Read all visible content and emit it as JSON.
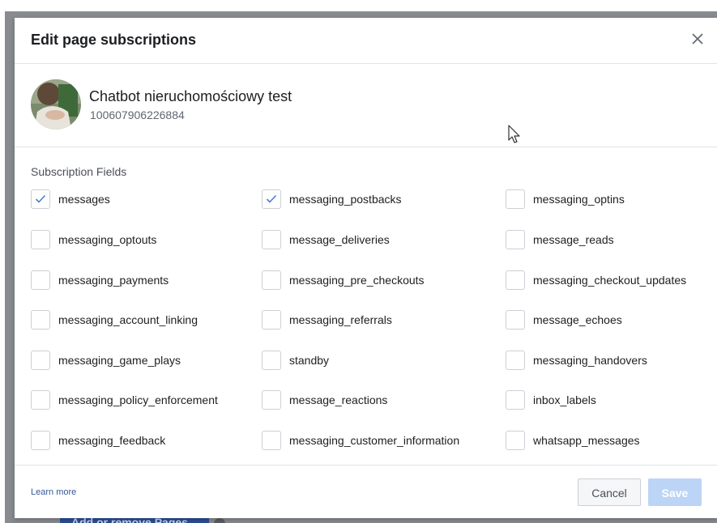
{
  "dialog": {
    "title": "Edit page subscriptions",
    "close_icon": "close-icon"
  },
  "page": {
    "name": "Chatbot nieruchomościowy test",
    "id": "100607906226884",
    "avatar_icon": "page-avatar"
  },
  "subscriptions": {
    "label": "Subscription Fields",
    "fields": [
      {
        "label": "messages",
        "checked": true
      },
      {
        "label": "messaging_postbacks",
        "checked": true
      },
      {
        "label": "messaging_optins",
        "checked": false
      },
      {
        "label": "messaging_optouts",
        "checked": false
      },
      {
        "label": "message_deliveries",
        "checked": false
      },
      {
        "label": "message_reads",
        "checked": false
      },
      {
        "label": "messaging_payments",
        "checked": false
      },
      {
        "label": "messaging_pre_checkouts",
        "checked": false
      },
      {
        "label": "messaging_checkout_updates",
        "checked": false
      },
      {
        "label": "messaging_account_linking",
        "checked": false
      },
      {
        "label": "messaging_referrals",
        "checked": false
      },
      {
        "label": "message_echoes",
        "checked": false
      },
      {
        "label": "messaging_game_plays",
        "checked": false
      },
      {
        "label": "standby",
        "checked": false
      },
      {
        "label": "messaging_handovers",
        "checked": false
      },
      {
        "label": "messaging_policy_enforcement",
        "checked": false
      },
      {
        "label": "message_reactions",
        "checked": false
      },
      {
        "label": "inbox_labels",
        "checked": false
      },
      {
        "label": "messaging_feedback",
        "checked": false
      },
      {
        "label": "messaging_customer_information",
        "checked": false
      },
      {
        "label": "whatsapp_messages",
        "checked": false
      }
    ]
  },
  "footer": {
    "learn_more": "Learn more",
    "cancel_label": "Cancel",
    "save_label": "Save"
  },
  "background": {
    "button_label": "Add or remove Pages"
  },
  "colors": {
    "check": "#4a7fd0",
    "link": "#365899",
    "save_disabled": "#bcd4f5"
  }
}
